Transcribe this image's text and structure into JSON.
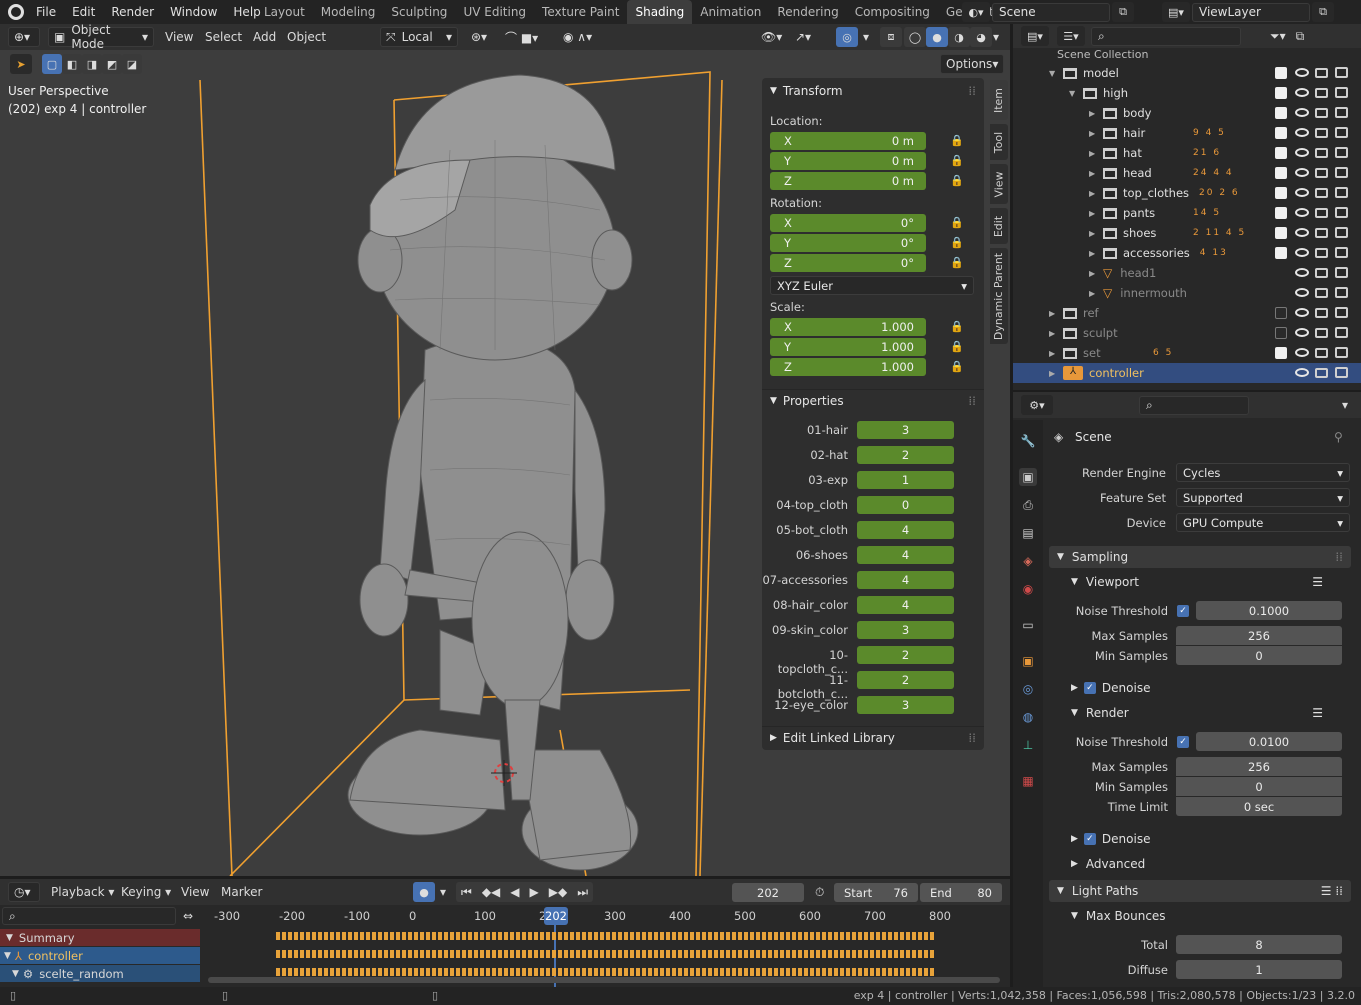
{
  "topbar": {
    "menus": [
      "File",
      "Edit",
      "Render",
      "Window",
      "Help"
    ],
    "workspaces": [
      "Layout",
      "Modeling",
      "Sculpting",
      "UV Editing",
      "Texture Paint",
      "Shading",
      "Animation",
      "Rendering",
      "Compositing",
      "Geometry Nc"
    ],
    "active_workspace": "Shading",
    "scene": "Scene",
    "view_layer": "ViewLayer"
  },
  "viewport_header": {
    "mode": "Object Mode",
    "menus": [
      "View",
      "Select",
      "Add",
      "Object"
    ],
    "orientation": "Local",
    "options": "Options"
  },
  "viewport": {
    "perspective": "User Perspective",
    "info": "(202) exp 4 | controller"
  },
  "n_panel": {
    "tabs": [
      "Item",
      "Tool",
      "View",
      "Edit",
      "Dynamic Parent"
    ],
    "transform_title": "Transform",
    "location_label": "Location:",
    "location": [
      {
        "axis": "X",
        "value": "0 m"
      },
      {
        "axis": "Y",
        "value": "0 m"
      },
      {
        "axis": "Z",
        "value": "0 m"
      }
    ],
    "rotation_label": "Rotation:",
    "rotation": [
      {
        "axis": "X",
        "value": "0°"
      },
      {
        "axis": "Y",
        "value": "0°"
      },
      {
        "axis": "Z",
        "value": "0°"
      }
    ],
    "rotation_mode": "XYZ Euler",
    "scale_label": "Scale:",
    "scale": [
      {
        "axis": "X",
        "value": "1.000"
      },
      {
        "axis": "Y",
        "value": "1.000"
      },
      {
        "axis": "Z",
        "value": "1.000"
      }
    ],
    "properties_title": "Properties",
    "properties": [
      {
        "name": "01-hair",
        "value": "3"
      },
      {
        "name": "02-hat",
        "value": "2"
      },
      {
        "name": "03-exp",
        "value": "1"
      },
      {
        "name": "04-top_cloth",
        "value": "0"
      },
      {
        "name": "05-bot_cloth",
        "value": "4"
      },
      {
        "name": "06-shoes",
        "value": "4"
      },
      {
        "name": "07-accessories",
        "value": "4"
      },
      {
        "name": "08-hair_color",
        "value": "4"
      },
      {
        "name": "09-skin_color",
        "value": "3"
      },
      {
        "name": "10-topcloth_c...",
        "value": "2"
      },
      {
        "name": "11-botcloth_c...",
        "value": "2"
      },
      {
        "name": "12-eye_color",
        "value": "3"
      }
    ],
    "linked_title": "Edit Linked Library"
  },
  "outliner": {
    "scene_collection": "Scene Collection",
    "rows": [
      {
        "name": "model",
        "level": 1,
        "checked": true
      },
      {
        "name": "high",
        "level": 2,
        "checked": true
      },
      {
        "name": "body",
        "level": 3,
        "checked": true,
        "badges": ""
      },
      {
        "name": "hair",
        "level": 3,
        "checked": true,
        "badges": "9 4 5"
      },
      {
        "name": "hat",
        "level": 3,
        "checked": true,
        "badges": "21 6"
      },
      {
        "name": "head",
        "level": 3,
        "checked": true,
        "badges": "24 4 4"
      },
      {
        "name": "top_clothes",
        "level": 3,
        "checked": true,
        "badges": "20 2 6"
      },
      {
        "name": "pants",
        "level": 3,
        "checked": true,
        "badges": "14 5"
      },
      {
        "name": "shoes",
        "level": 3,
        "checked": true,
        "badges": "2 11 4 5"
      },
      {
        "name": "accessories",
        "level": 3,
        "checked": true,
        "badges": "4 13"
      },
      {
        "name": "head1",
        "level": 3,
        "dim": true,
        "badges": ""
      },
      {
        "name": "innermouth",
        "level": 3,
        "dim": true,
        "badges": ""
      },
      {
        "name": "ref",
        "level": 1,
        "dim": true,
        "checked": false
      },
      {
        "name": "sculpt",
        "level": 1,
        "dim": true,
        "checked": false
      },
      {
        "name": "set",
        "level": 1,
        "dim": true,
        "checked": true,
        "badges": "6 5"
      },
      {
        "name": "controller",
        "level": 1,
        "selected": true
      }
    ]
  },
  "properties_editor": {
    "context": "Scene",
    "render_engine_label": "Render Engine",
    "render_engine": "Cycles",
    "feature_set_label": "Feature Set",
    "feature_set": "Supported",
    "device_label": "Device",
    "device": "GPU Compute",
    "sampling": "Sampling",
    "viewport": "Viewport",
    "noise_threshold_label": "Noise Threshold",
    "vp_noise_threshold": "0.1000",
    "max_samples_label": "Max Samples",
    "vp_max_samples": "256",
    "min_samples_label": "Min Samples",
    "vp_min_samples": "0",
    "denoise": "Denoise",
    "render": "Render",
    "r_noise_threshold": "0.0100",
    "r_max_samples": "256",
    "r_min_samples": "0",
    "time_limit_label": "Time Limit",
    "r_time_limit": "0 sec",
    "advanced": "Advanced",
    "light_paths": "Light Paths",
    "max_bounces": "Max Bounces",
    "total_label": "Total",
    "total": "8",
    "diffuse_label": "Diffuse",
    "diffuse": "1"
  },
  "timeline": {
    "menus": [
      "Playback",
      "Keying",
      "View",
      "Marker"
    ],
    "current_frame": "202",
    "start_label": "Start",
    "start": "76",
    "end_label": "End",
    "end": "80",
    "ruler": [
      "-300",
      "-200",
      "-100",
      "0",
      "100",
      "200",
      "300",
      "400",
      "500",
      "600",
      "700",
      "800"
    ],
    "channels": [
      {
        "name": "Summary"
      },
      {
        "name": "controller"
      },
      {
        "name": "scelte_random"
      }
    ]
  },
  "statusbar": {
    "text": "exp 4 | controller | Verts:1,042,358 | Faces:1,056,598 | Tris:2,080,578 | Objects:1/23 | 3.2.0"
  },
  "colors": {
    "accent_blue": "#4772b3",
    "field_green": "#5b8a2b",
    "selection_orange": "#e8983a"
  }
}
